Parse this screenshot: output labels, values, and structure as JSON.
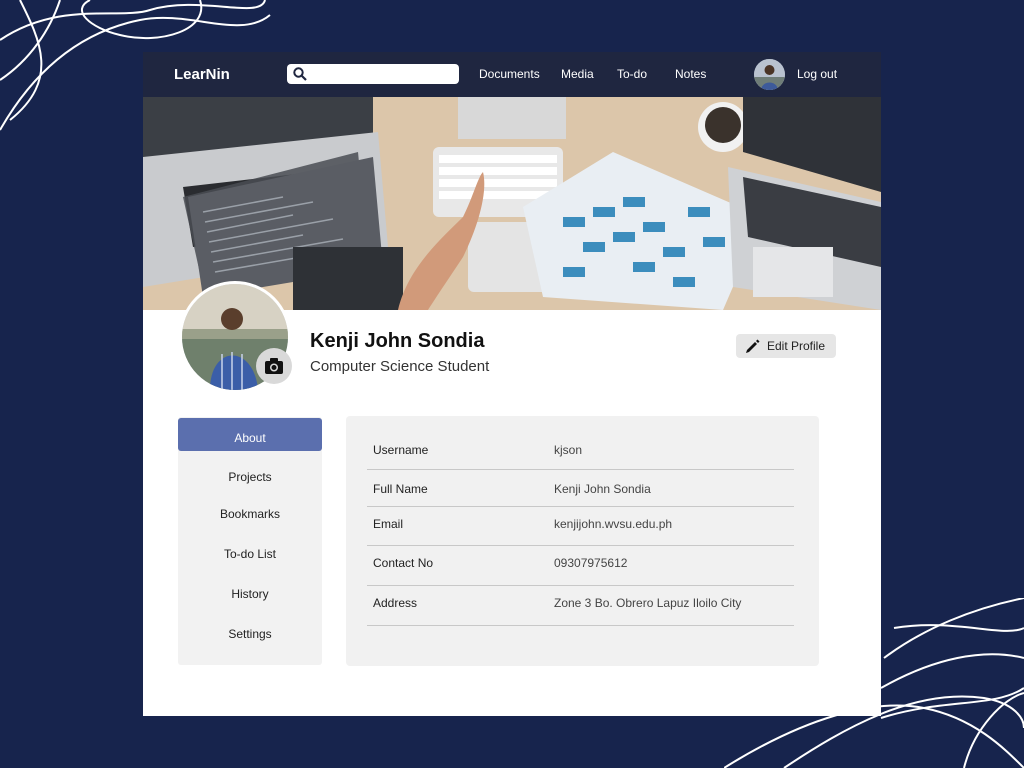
{
  "nav": {
    "brand": "LearNin",
    "search_placeholder": "",
    "links": [
      "Documents",
      "Media",
      "To-do",
      "Notes"
    ],
    "logout": "Log out"
  },
  "profile": {
    "name": "Kenji John Sondia",
    "role": "Computer Science Student",
    "edit_label": "Edit Profile"
  },
  "sidebar": {
    "items": [
      {
        "label": "About",
        "active": true
      },
      {
        "label": "Projects"
      },
      {
        "label": "Bookmarks"
      },
      {
        "label": "To-do List"
      },
      {
        "label": "History"
      },
      {
        "label": "Settings"
      }
    ]
  },
  "about": {
    "rows": [
      {
        "label": "Username",
        "value": "kjson"
      },
      {
        "label": "Full Name",
        "value": "Kenji John Sondia"
      },
      {
        "label": "Email",
        "value": "kenjijohn.wvsu.edu.ph"
      },
      {
        "label": "Contact No",
        "value": "09307975612"
      },
      {
        "label": "Address",
        "value": "Zone 3 Bo. Obrero Lapuz Iloilo City"
      }
    ]
  },
  "colors": {
    "background": "#17244d",
    "navbar": "#1f2640",
    "accent": "#5b6fae"
  }
}
